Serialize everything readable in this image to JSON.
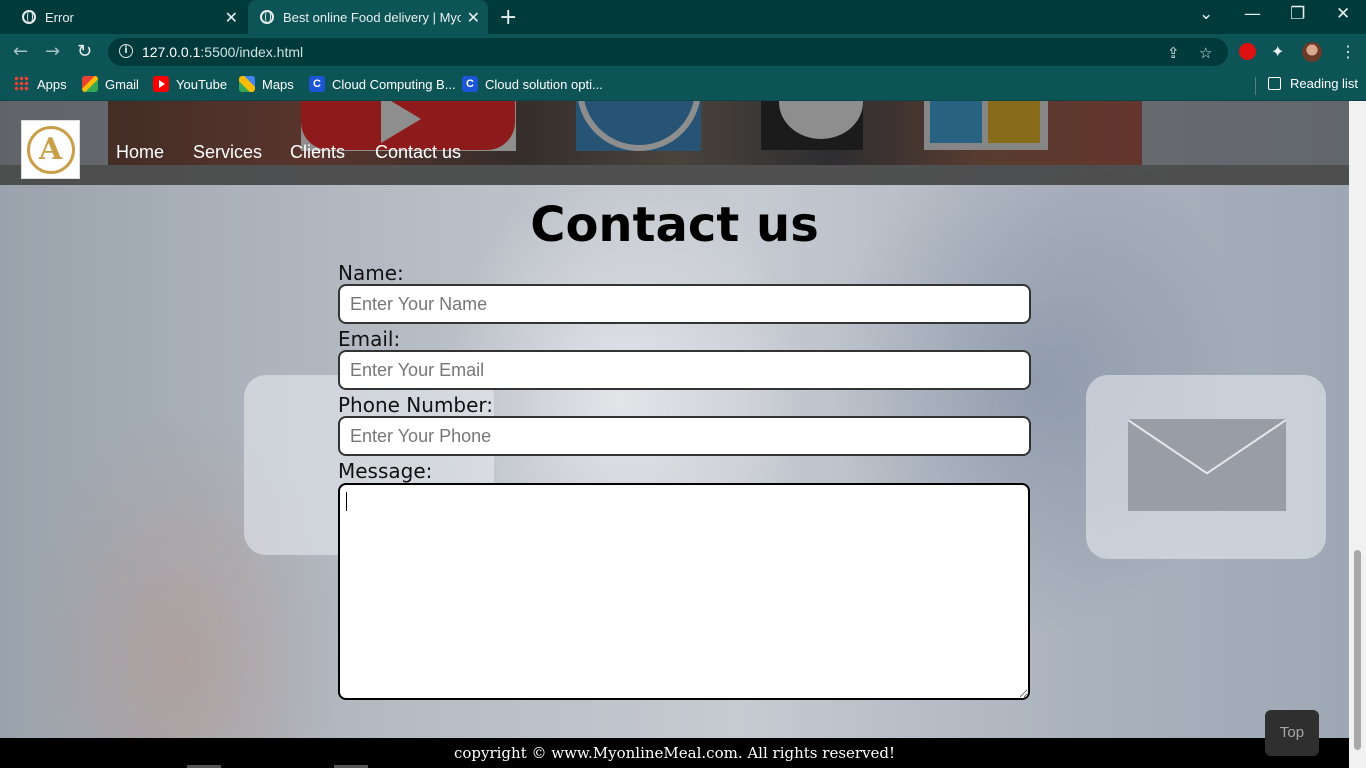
{
  "browser": {
    "tabs": [
      {
        "title": "Error",
        "active": false
      },
      {
        "title": "Best online Food delivery | Myonl",
        "active": true
      }
    ],
    "new_tab_icon": "plus-icon",
    "url_host": "127.0.0.1",
    "url_rest": ":5500/index.html",
    "bookmarks": [
      {
        "label": "Apps",
        "icon": "apps-grid-icon"
      },
      {
        "label": "Gmail",
        "icon": "gmail-icon"
      },
      {
        "label": "YouTube",
        "icon": "youtube-icon"
      },
      {
        "label": "Maps",
        "icon": "maps-icon"
      },
      {
        "label": "Cloud Computing B...",
        "icon": "cloud-c-icon"
      },
      {
        "label": "Cloud solution opti...",
        "icon": "cloud-c-icon"
      }
    ],
    "reading_list": "Reading list"
  },
  "site": {
    "nav": [
      "Home",
      "Services",
      "Clients",
      "Contact us"
    ],
    "contact_title": "Contact us",
    "form": {
      "name_label": "Name:",
      "name_placeholder": "Enter Your Name",
      "email_label": "Email:",
      "email_placeholder": "Enter Your Email",
      "phone_label": "Phone Number:",
      "phone_placeholder": "Enter Your Phone",
      "message_label": "Message:",
      "message_value": ""
    },
    "footer": "copyright © www.MyonlineMeal.com. All rights reserved!",
    "top_button": "Top"
  },
  "colors": {
    "chrome_dark": "#013a3b",
    "chrome_toolbar": "#0c5456",
    "footer_bg": "#000000",
    "logo_gold": "#c9a04a"
  }
}
